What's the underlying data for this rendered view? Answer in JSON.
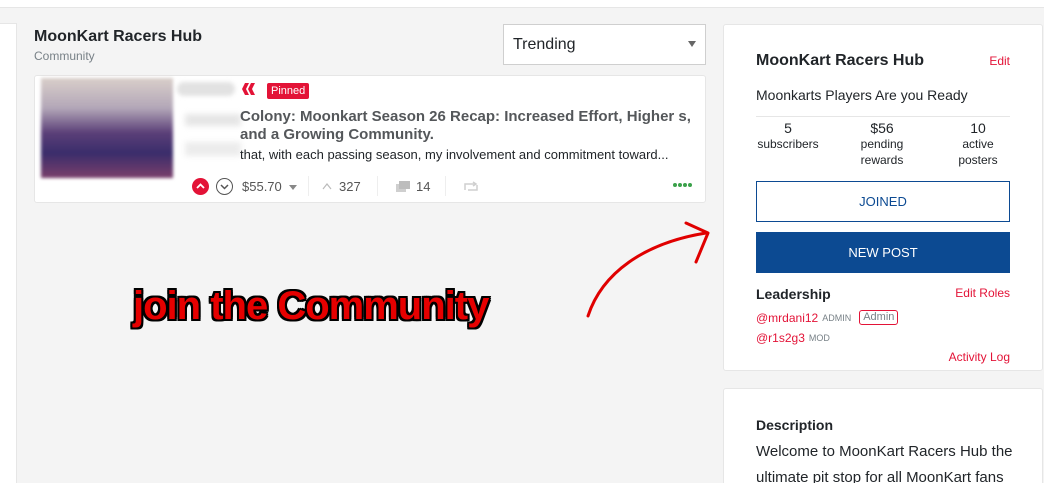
{
  "community": {
    "title": "MoonKart Racers Hub",
    "subtitle": "Community"
  },
  "sort": {
    "selected": "Trending"
  },
  "post": {
    "pinned_label": "Pinned",
    "title": "Colony: Moonkart Season 26 Recap: Increased Effort, Higher s, and a Growing Community.",
    "snippet": "that, with each passing season, my involvement and commitment toward...",
    "payout": "$55.70",
    "votes": "327",
    "comments": "14"
  },
  "annotation": {
    "text": "join the Community"
  },
  "sidebar": {
    "title": "MoonKart Racers Hub",
    "edit_label": "Edit",
    "about": "Moonkarts Players Are you Ready",
    "stats": {
      "subscribers_value": "5",
      "subscribers_label": "subscribers",
      "pending_value": "$56",
      "pending_label_1": "pending",
      "pending_label_2": "rewards",
      "active_value": "10",
      "active_label_1": "active",
      "active_label_2": "posters"
    },
    "joined_label": "JOINED",
    "new_post_label": "NEW POST",
    "leadership_title": "Leadership",
    "edit_roles_label": "Edit Roles",
    "leaders": [
      {
        "user": "@mrdani12",
        "role": "ADMIN",
        "badge": "Admin"
      },
      {
        "user": "@r1s2g3",
        "role": "MOD"
      }
    ],
    "activity_log_label": "Activity Log"
  },
  "description": {
    "title": "Description",
    "text": "Welcome to MoonKart Racers Hub the ultimate pit stop for all MoonKart fans"
  },
  "colors": {
    "accent": "#e31337",
    "primary_button": "#0c4a92",
    "annotation": "#e60000"
  }
}
